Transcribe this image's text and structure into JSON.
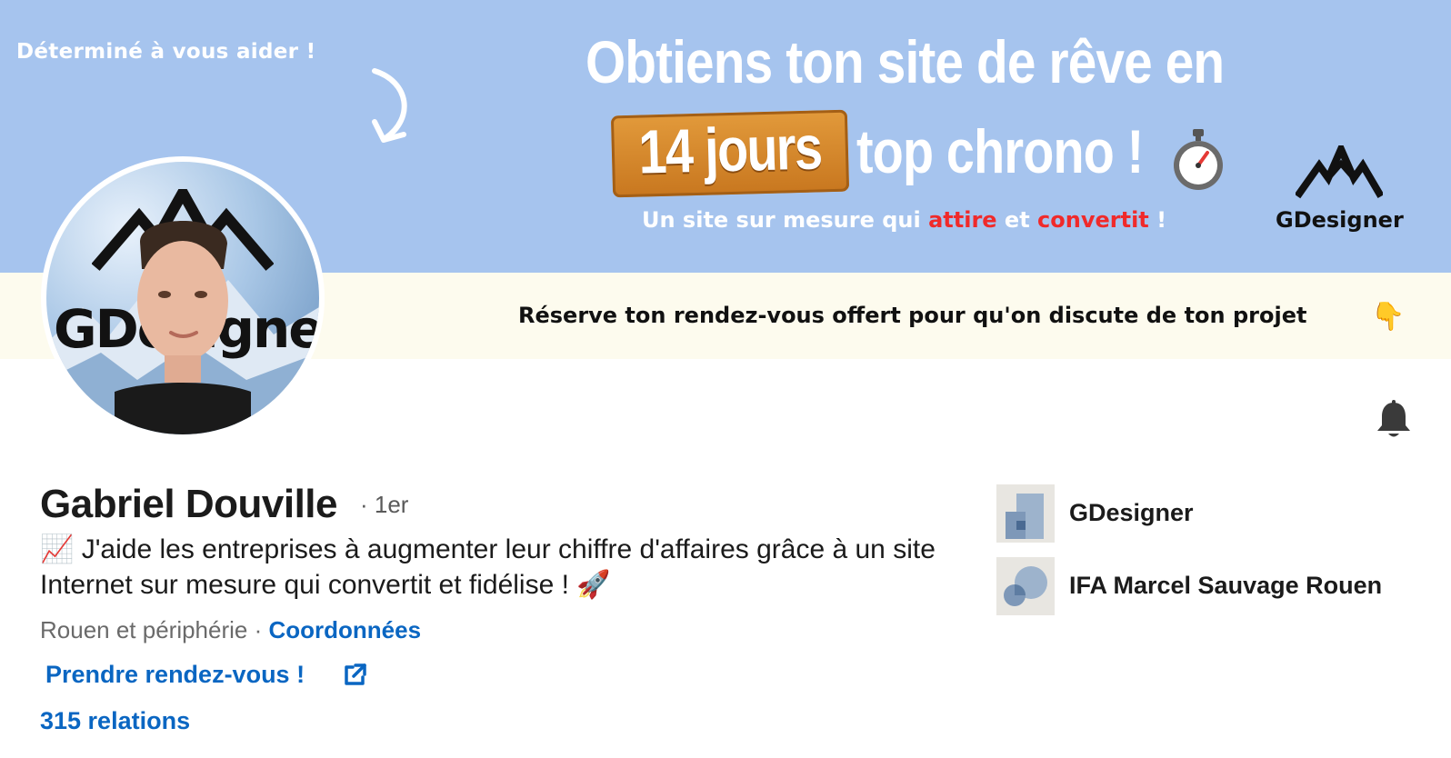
{
  "banner": {
    "tagline": "Déterminé à vous aider !",
    "headline_line1": "Obtiens ton site de rêve en",
    "highlight": "14 jours",
    "headline_line2_rest": "top chrono !",
    "subline_start": "Un site sur mesure qui ",
    "subline_red1": "attire",
    "subline_mid": " et ",
    "subline_red2": "convertit",
    "subline_end": " !",
    "brand_name": "GDesigner",
    "cta": "Réserve ton rendez-vous offert  pour qu'on discute de ton projet",
    "point_emoji": "👇",
    "colors": {
      "sky": "#a6c4ee",
      "cream": "#fdfbee",
      "wood": "#d88a2d",
      "red": "#f02a2a"
    }
  },
  "avatar": {
    "logo_text": "GDesigner"
  },
  "profile": {
    "name": "Gabriel Douville",
    "degree": "· 1er",
    "headline": "📈 J'aide les entreprises à augmenter leur chiffre d'affaires grâce à un site Internet sur mesure qui convertit et fidélise ! 🚀",
    "location": "Rouen et périphérie",
    "separator": " · ",
    "contact_link": "Coordonnées",
    "booking_link": "Prendre rendez-vous !",
    "connections": "315 relations"
  },
  "organizations": [
    {
      "name": "GDesigner",
      "icon": "company-logo-placeholder"
    },
    {
      "name": "IFA Marcel Sauvage Rouen",
      "icon": "school-logo-placeholder"
    }
  ],
  "icons": {
    "bell": "bell-icon",
    "external": "external-link-icon",
    "timer": "stopwatch-icon",
    "arrow": "curved-arrow-icon"
  },
  "accent_color": "#0a66c2"
}
